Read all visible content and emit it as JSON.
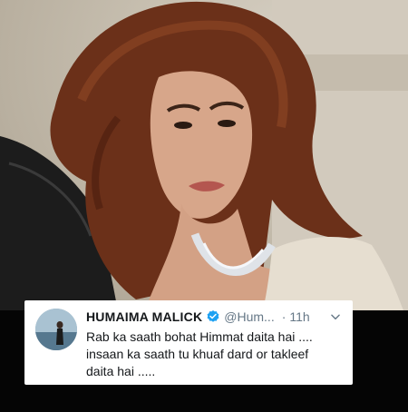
{
  "photo": {
    "subject": "portrait photo",
    "tones": {
      "background": "#c9c1b2",
      "hair": "#6b3019",
      "skin": "#d7a68a",
      "jacket": "#1c1c1c",
      "dress": "#e6ded0",
      "necklace": "#dfe3e8"
    }
  },
  "tweet": {
    "display_name": "HUMAIMA MALICK",
    "handle": "@Hum...",
    "separator": "·",
    "time": "11h",
    "text_lines": [
      "Rab ka saath bohat Himmat daita hai ....",
      "insaan ka saath tu khuaf dard or takleef",
      "daita hai ....."
    ]
  },
  "colors": {
    "card_bg": "#ffffff",
    "name": "#14171a",
    "secondary": "#657786",
    "verified": "#1da1f2",
    "page_bg": "#000000"
  },
  "icons": {
    "verified": "verified-badge-icon",
    "more": "chevron-down-icon",
    "avatar": "profile-avatar"
  }
}
